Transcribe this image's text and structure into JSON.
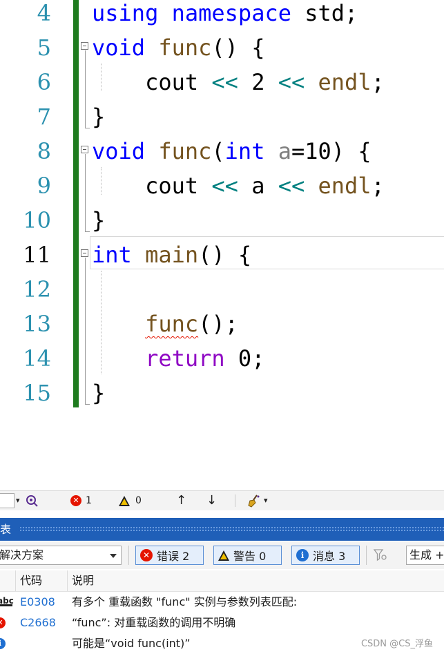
{
  "editor": {
    "line_numbers": [
      "4",
      "5",
      "6",
      "7",
      "8",
      "9",
      "10",
      "11",
      "12",
      "13",
      "14",
      "15"
    ],
    "current_line": "11",
    "lines": [
      [
        {
          "t": "using namespace",
          "c": "kw"
        },
        {
          "t": " std;",
          "c": ""
        }
      ],
      [
        {
          "t": "void",
          "c": "kw"
        },
        {
          "t": " ",
          "c": ""
        },
        {
          "t": "func",
          "c": "fn"
        },
        {
          "t": "() {",
          "c": ""
        }
      ],
      [
        {
          "t": "    cout ",
          "c": ""
        },
        {
          "t": "<<",
          "c": "op"
        },
        {
          "t": " 2 ",
          "c": ""
        },
        {
          "t": "<<",
          "c": "op"
        },
        {
          "t": " ",
          "c": ""
        },
        {
          "t": "endl",
          "c": "fn"
        },
        {
          "t": ";",
          "c": ""
        }
      ],
      [
        {
          "t": "}",
          "c": ""
        }
      ],
      [
        {
          "t": "void",
          "c": "kw"
        },
        {
          "t": " ",
          "c": ""
        },
        {
          "t": "func",
          "c": "fn"
        },
        {
          "t": "(",
          "c": ""
        },
        {
          "t": "int",
          "c": "kw"
        },
        {
          "t": " ",
          "c": ""
        },
        {
          "t": "a",
          "c": "param"
        },
        {
          "t": "=10) {",
          "c": ""
        }
      ],
      [
        {
          "t": "    cout ",
          "c": ""
        },
        {
          "t": "<<",
          "c": "op"
        },
        {
          "t": " a ",
          "c": ""
        },
        {
          "t": "<<",
          "c": "op"
        },
        {
          "t": " ",
          "c": ""
        },
        {
          "t": "endl",
          "c": "fn"
        },
        {
          "t": ";",
          "c": ""
        }
      ],
      [
        {
          "t": "}",
          "c": ""
        }
      ],
      [
        {
          "t": "int",
          "c": "kw"
        },
        {
          "t": " ",
          "c": ""
        },
        {
          "t": "main",
          "c": "fn"
        },
        {
          "t": "() {",
          "c": ""
        }
      ],
      [],
      [
        {
          "t": "    ",
          "c": ""
        },
        {
          "t": "func",
          "c": "fn squiggle"
        },
        {
          "t": "();",
          "c": ""
        }
      ],
      [
        {
          "t": "    ",
          "c": ""
        },
        {
          "t": "return",
          "c": "ctl"
        },
        {
          "t": " 0;",
          "c": ""
        }
      ],
      [
        {
          "t": "}",
          "c": ""
        }
      ]
    ]
  },
  "toolbar": {
    "error_count": "1",
    "warning_count": "0",
    "error_icon_glyph": "✕",
    "up_arrow": "↑",
    "down_arrow": "↓",
    "dropdown_caret": "▾"
  },
  "error_list": {
    "title": "表",
    "scope": "解决方案",
    "errors_filter": "错误 2",
    "warnings_filter": "警告 0",
    "messages_filter": "消息 3",
    "build_filter": "生成 +",
    "col_code": "代码",
    "col_desc": "说明",
    "rows": [
      {
        "icon": "abc",
        "code": "E0308",
        "desc": "有多个 重载函数 \"func\" 实例与参数列表匹配:"
      },
      {
        "icon": "error",
        "code": "C2668",
        "desc": "“func”: 对重载函数的调用不明确"
      },
      {
        "icon": "info",
        "code": "",
        "desc": "可能是“void func(int)”"
      }
    ]
  },
  "watermark": "CSDN @CS_浮鱼",
  "colors": {
    "keyword": "#0000ff",
    "function": "#74531f",
    "operator": "#008080",
    "control": "#8f08c4",
    "line_number": "#2b91af",
    "change_bar": "#1e7b1e",
    "error": "#e51400",
    "panel_header": "#1f5fb8"
  }
}
